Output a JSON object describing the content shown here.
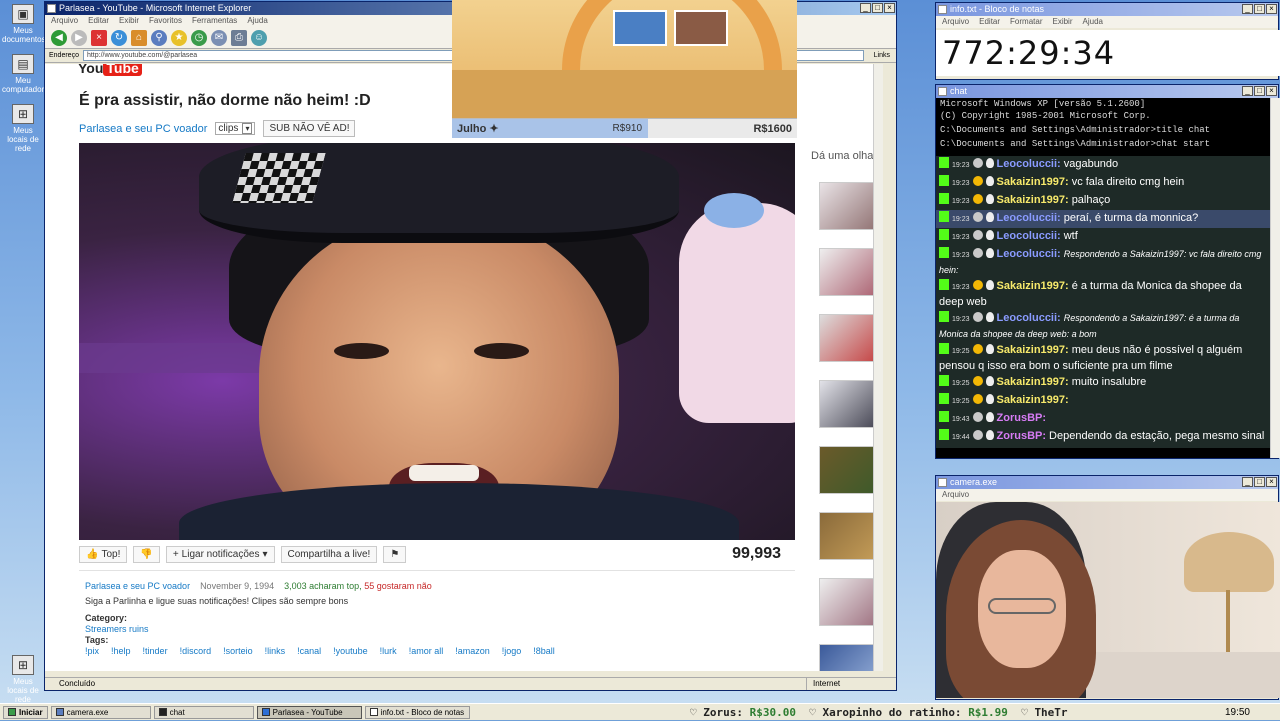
{
  "desktop": {
    "icons": [
      "Meus documentos",
      "Meu computador",
      "Meus locais de rede",
      "Lixeira",
      "Internet Explorer",
      "Windows Media Player",
      "Meus locais de rede"
    ]
  },
  "ie": {
    "title": "Parlasea - YouTube - Microsoft Internet Explorer",
    "menu": [
      "Arquivo",
      "Editar",
      "Exibir",
      "Favoritos",
      "Ferramentas",
      "Ajuda"
    ],
    "address_label": "Endereço",
    "address": "http://www.youtube.com/@parlasea",
    "links_label": "Links",
    "status": "Concluído",
    "zone": "Internet"
  },
  "yt": {
    "logo_you": "You",
    "logo_tube": "Tube",
    "title": "É pra assistir, não dorme não heim! :D",
    "channel": "Parlasea e seu PC voador",
    "clips_label": "clips",
    "subscribe": "SUB NÃO VÊ AD!",
    "like": "Top!",
    "notify": "Ligar notificações",
    "share": "Compartilha a live!",
    "views": "99,993",
    "up_next": "Dá uma olhada",
    "desc": {
      "channel": "Parlasea e seu PC voador",
      "date": "November 9, 1994",
      "likes": "3,003 acharam top,",
      "dislikes": "55 gostaram não",
      "text": "Siga a Parlinha e ligue suas notificações! Clipes são sempre bons",
      "category_label": "Category:",
      "category": "Streamers ruins",
      "tags_label": "Tags:",
      "tags": [
        "!pix",
        "!help",
        "!tinder",
        "!discord",
        "!sorteio",
        "!links",
        "!canal",
        "!youtube",
        "!lurk",
        "!amor all",
        "!amazon",
        "!jogo",
        "!8ball"
      ]
    }
  },
  "game": {
    "month": "Julho",
    "price1": "R$910",
    "price2": "R$1600"
  },
  "notepad": {
    "title": "info.txt - Bloco de notas",
    "menu": [
      "Arquivo",
      "Editar",
      "Formatar",
      "Exibir",
      "Ajuda"
    ],
    "timer": "772:29:34"
  },
  "chat": {
    "title": "chat",
    "cmd": [
      "Microsoft Windows XP [versão 5.1.2600]",
      "(C) Copyright 1985-2001 Microsoft Corp.",
      "",
      "C:\\Documents and Settings\\Administrador>title chat",
      "",
      "C:\\Documents and Settings\\Administrador>chat start"
    ],
    "messages": [
      {
        "time": "19:23",
        "user": "Leocoluccii:",
        "text": "vagabundo",
        "color": "#8a9bff"
      },
      {
        "time": "19:23",
        "user": "Sakaizin1997:",
        "text": "vc fala direito cmg hein",
        "color": "#f7e96b"
      },
      {
        "time": "19:23",
        "user": "Sakaizin1997:",
        "text": "palhaço",
        "color": "#f7e96b"
      },
      {
        "time": "19:23",
        "user": "Leocoluccii:",
        "text": "peraí, é turma da monnica?",
        "color": "#8a9bff"
      },
      {
        "time": "19:23",
        "user": "Leocoluccii:",
        "text": "wtf",
        "color": "#8a9bff"
      },
      {
        "time": "19:23",
        "user": "Leocoluccii:",
        "text": "Respondendo a Sakaizin1997: vc fala direito cmg hein:",
        "color": "#8a9bff",
        "reply": true
      },
      {
        "time": "19:23",
        "user": "Sakaizin1997:",
        "text": "é a turma da Monica da shopee da deep web",
        "color": "#f7e96b"
      },
      {
        "time": "19:23",
        "user": "Leocoluccii:",
        "text": "Respondendo a Sakaizin1997: é a turma da Monica da shopee da deep web: a bom",
        "color": "#8a9bff",
        "reply": true
      },
      {
        "time": "19:25",
        "user": "Sakaizin1997:",
        "text": "meu deus não é possível q alguém pensou q isso era bom o suficiente pra um filme",
        "color": "#f7e96b"
      },
      {
        "time": "19:25",
        "user": "Sakaizin1997:",
        "text": "muito insalubre",
        "color": "#f7e96b"
      },
      {
        "time": "19:25",
        "user": "Sakaizin1997:",
        "text": "",
        "color": "#f7e96b"
      },
      {
        "time": "19:43",
        "user": "ZorusBP:",
        "text": "",
        "color": "#d77cf5"
      },
      {
        "time": "19:44",
        "user": "ZorusBP:",
        "text": "Dependendo da estação, pega mesmo sinal",
        "color": "#d77cf5"
      }
    ]
  },
  "camera": {
    "title": "camera.exe",
    "menu": "Arquivo"
  },
  "taskbar": {
    "start": "Iniciar",
    "tasks": [
      "camera.exe",
      "chat",
      "Parlasea - YouTube",
      "info.txt - Bloco de notas"
    ],
    "ticker": [
      {
        "name": "Zorus:",
        "amount": "R$30.00"
      },
      {
        "name": "Xaropinho do ratinho:",
        "amount": "R$1.99"
      },
      {
        "name": "TheTr",
        "amount": ""
      }
    ],
    "clock": "19:50"
  },
  "colors": {
    "accent": "#0a246a",
    "yt_red": "#e62117",
    "link": "#167ac6",
    "kick_green": "#53fc18"
  }
}
